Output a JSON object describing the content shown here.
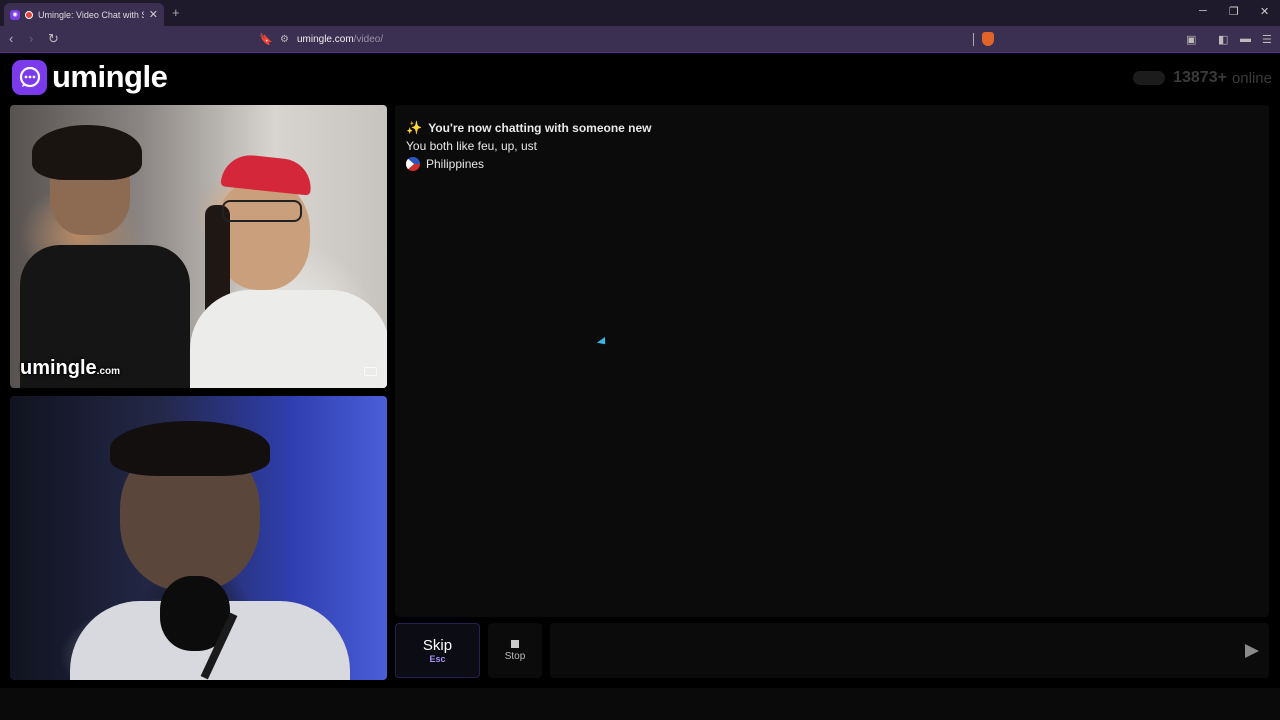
{
  "browser": {
    "tab_title": "Umingle: Video Chat with Strangers",
    "tab_close": "✕",
    "new_tab": "+",
    "url_host": "umingle.com",
    "url_path": "/video/",
    "window_controls": [
      "─",
      "❐",
      "✕"
    ],
    "nav": {
      "back": "‹",
      "forward": "›",
      "reload": "↻"
    }
  },
  "header": {
    "logo_text": "umingle",
    "online_count": "13873+",
    "online_label": "online"
  },
  "videos": {
    "stranger_watermark": "umingle",
    "stranger_watermark_suffix": ".com"
  },
  "chat": {
    "messages": [
      {
        "icon": "✨",
        "text": "You're now chatting with someone new"
      },
      {
        "text": "You both like feu, up, ust"
      },
      {
        "icon": "philippines-flag",
        "text": "Philippines"
      }
    ]
  },
  "controls": {
    "skip_label": "Skip",
    "skip_key": "Esc",
    "stop_label": "Stop",
    "message_placeholder": ""
  },
  "colors": {
    "brand": "#7c3aed",
    "accent": "#a98ff5",
    "background": "#000000",
    "panel": "#0b0b0b"
  }
}
